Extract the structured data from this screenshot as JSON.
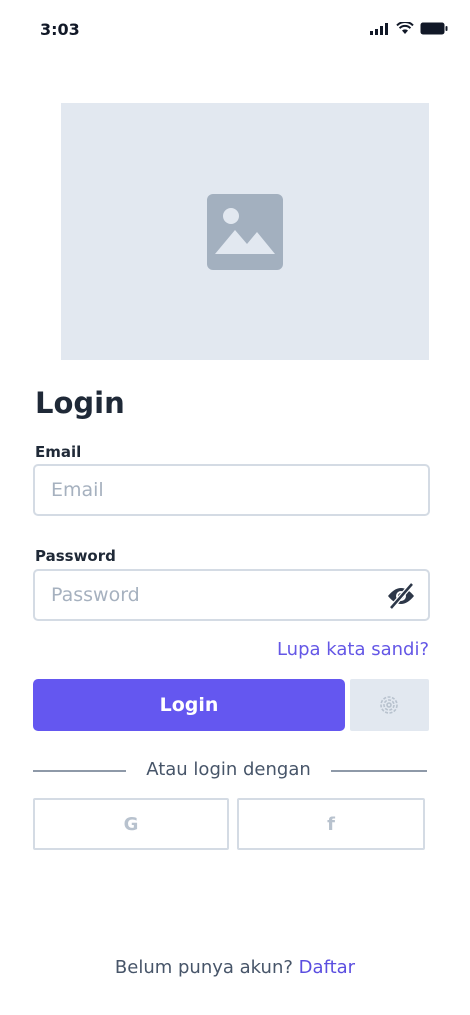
{
  "status_bar": {
    "time": "3:03",
    "icons": [
      "signal-icon",
      "wifi-icon",
      "battery-icon"
    ]
  },
  "hero": {
    "icon": "image-placeholder-icon"
  },
  "form": {
    "title": "Login",
    "email_label": "Email",
    "email_placeholder": "Email",
    "email_value": "",
    "password_label": "Password",
    "password_placeholder": "Password",
    "password_value": "",
    "password_toggle_icon": "eye-off-icon",
    "forgot_link": "Lupa kata sandi?",
    "login_button": "Login",
    "fingerprint_icon": "fingerprint-icon"
  },
  "social": {
    "divider_text": "Atau login dengan",
    "google_label": "G",
    "facebook_label": "f"
  },
  "footer": {
    "prompt": "Belum punya akun?",
    "register_link": "Daftar"
  },
  "colors": {
    "primary": "#6457f0",
    "link": "#6457e6",
    "placeholder_bg": "#e2e8f0",
    "input_border": "#d4dbe4"
  }
}
